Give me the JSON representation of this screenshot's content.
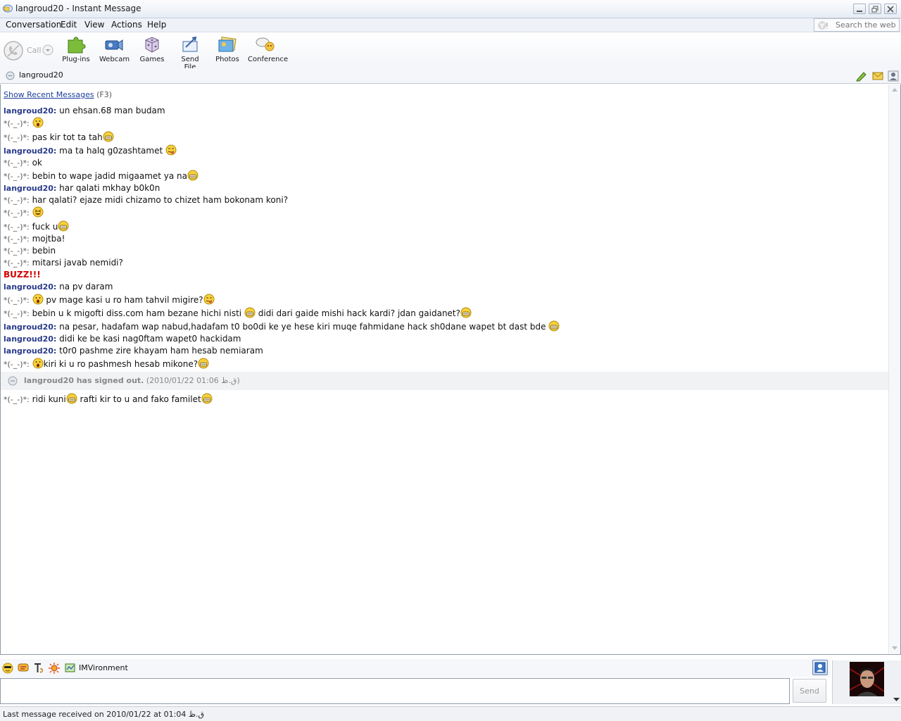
{
  "window": {
    "title": "langroud20 - Instant Message"
  },
  "menu": [
    "Conversation",
    "Edit",
    "View",
    "Actions",
    "Help"
  ],
  "search": {
    "placeholder": "Search the web"
  },
  "toolbar": {
    "call": "Call",
    "plugins": "Plug-ins",
    "webcam": "Webcam",
    "games": "Games",
    "send_file": "Send File",
    "photos": "Photos",
    "conference": "Conference"
  },
  "contact": {
    "name": "langroud20"
  },
  "history": {
    "link": "Show Recent Messages",
    "shortcut": "(F3)"
  },
  "users": {
    "them": "langroud20:",
    "me": "*(-_-)*:"
  },
  "messages": [
    {
      "text": "un ehsan.68 man budam"
    },
    {
      "text": ""
    },
    {
      "text": "pas kir tot ta tah"
    },
    {
      "text": "ma ta halq g0zashtamet "
    },
    {
      "text": "ok"
    },
    {
      "text": "bebin to wape jadid migaamet ya na"
    },
    {
      "text": "har qalati mkhay b0k0n"
    },
    {
      "text": "har qalati? ejaze midi chizamo to chizet ham bokonam koni?"
    },
    {
      "text": ""
    },
    {
      "text": "fuck u"
    },
    {
      "text": "mojtba!"
    },
    {
      "text": "bebin"
    },
    {
      "text": "mitarsi javab nemidi?"
    },
    {
      "text": "BUZZ!!!"
    },
    {
      "text": "na pv daram"
    },
    {
      "text": " pv mage kasi u ro ham tahvil migire?"
    },
    {
      "text": "bebin u k migofti diss.com ham bezane hichi nisti ",
      "text2": " didi dari gaide mishi hack kardi? jdan gaidanet?"
    },
    {
      "text": "na pesar, hadafam wap nabud,hadafam t0 bo0di ke ye hese kiri muqe fahmidane hack sh0dane wapet bt dast bde "
    },
    {
      "text": "didi ke be kasi nag0ftam wapet0 hackidam"
    },
    {
      "text": "t0r0 pashme zire khayam ham hesab nemiaram"
    },
    {
      "text": "kiri ki u ro pashmesh hesab mikone?"
    },
    {
      "text": "ridi kuni",
      "text2": " rafti kir to u and fako familet"
    }
  ],
  "signout": {
    "name": "langroud20 has signed out.",
    "time": "(2010/01/22 01:06 ق.ظ)"
  },
  "imvironment": {
    "label": "IMVironment"
  },
  "send": {
    "label": "Send"
  },
  "status": {
    "text": "Last message received on 2010/01/22 at 01:04 ق.ظ"
  },
  "colors": {
    "them": "#283a8a",
    "buzz": "#d40000",
    "link": "#1d3f9b"
  }
}
